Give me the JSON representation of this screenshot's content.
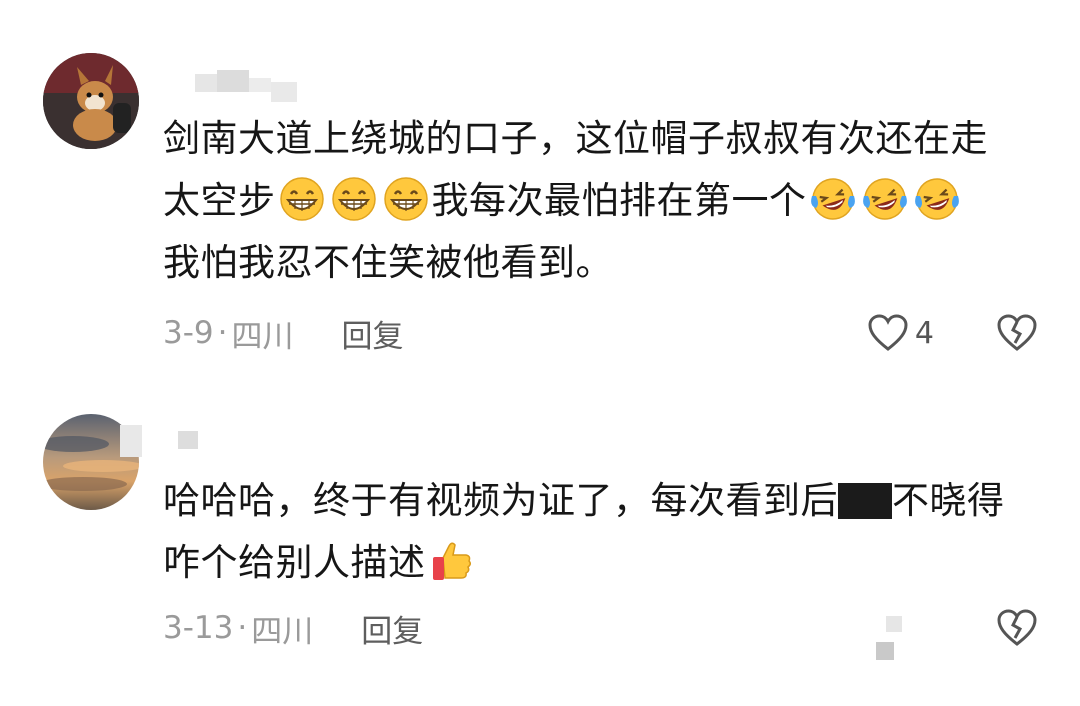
{
  "comments": [
    {
      "line1": "剑南大道上绕城的口子，这位帽子叔叔有次还在走",
      "line2_a": "太空步",
      "line2_b": "我每次最怕排在第一个",
      "line3": "我怕我忍不住笑被他看到。",
      "date": "3-9",
      "sep": "·",
      "location": "四川",
      "reply_label": "回复",
      "like_count": "4",
      "emoji_grin": "grinning-face-icon",
      "emoji_laugh": "laughing-crying-face-icon"
    },
    {
      "line1_a": "哈哈哈，终于有视频为证了，每次看到后",
      "line1_b": "不晓得",
      "line2": "咋个给别人描述",
      "date": "3-13",
      "sep": "·",
      "location": "四川",
      "reply_label": "回复",
      "emoji_thumb": "thumbs-up-icon"
    }
  ],
  "colors": {
    "text": "#161616",
    "meta": "#9a9a9a",
    "reply": "#5e5e5e",
    "emoji_yellow": "#FFC83D"
  }
}
